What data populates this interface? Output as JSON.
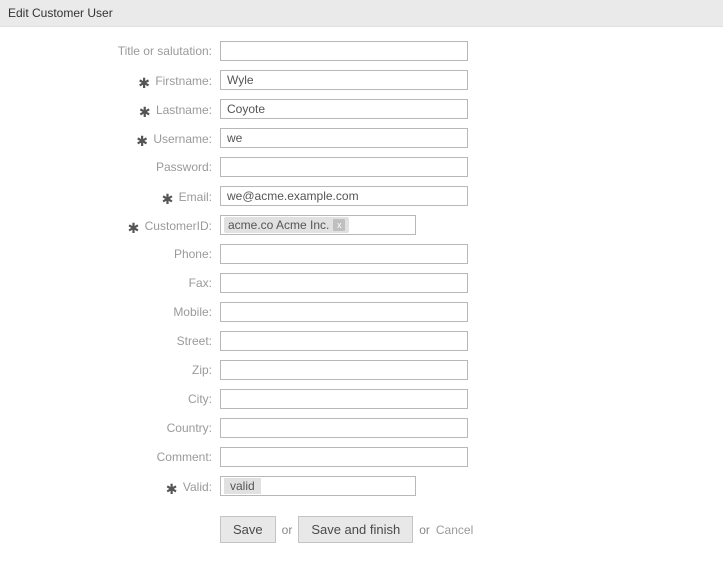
{
  "header": {
    "title": "Edit Customer User"
  },
  "labels": {
    "title_or_salutation": "Title or salutation:",
    "firstname": "Firstname:",
    "lastname": "Lastname:",
    "username": "Username:",
    "password": "Password:",
    "email": "Email:",
    "customer_id": "CustomerID:",
    "phone": "Phone:",
    "fax": "Fax:",
    "mobile": "Mobile:",
    "street": "Street:",
    "zip": "Zip:",
    "city": "City:",
    "country": "Country:",
    "comment": "Comment:",
    "valid": "Valid:"
  },
  "values": {
    "title_or_salutation": "",
    "firstname": "Wyle",
    "lastname": "Coyote",
    "username": "we",
    "password": "",
    "email": "we@acme.example.com",
    "customer_id": "acme.co Acme Inc.",
    "phone": "",
    "fax": "",
    "mobile": "",
    "street": "",
    "zip": "",
    "city": "",
    "country": "",
    "comment": "",
    "valid": "valid"
  },
  "required_marker": "✱",
  "actions": {
    "save": "Save",
    "or1": "or",
    "save_finish": "Save and finish",
    "or2": "or",
    "cancel": "Cancel"
  }
}
